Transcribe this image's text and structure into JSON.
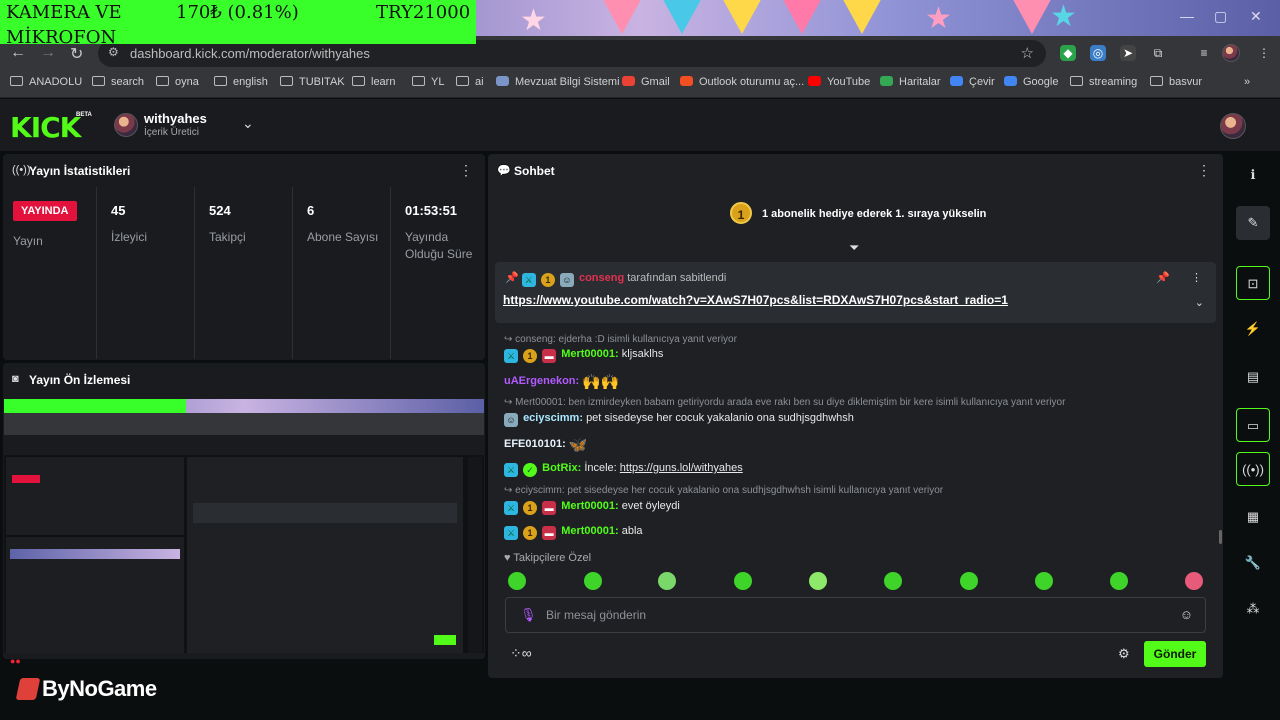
{
  "overlay": {
    "line1": "KAMERA VE",
    "line2": "MİKROFON",
    "price": "170₺ (0.81%)",
    "total": "TRY21000"
  },
  "browser": {
    "url": "dashboard.kick.com/moderator/withyahes",
    "bookmarks": [
      {
        "label": "ANADOLU",
        "icon": "folder-icon"
      },
      {
        "label": "search",
        "icon": "folder-icon"
      },
      {
        "label": "oyna",
        "icon": "folder-icon"
      },
      {
        "label": "english",
        "icon": "folder-icon"
      },
      {
        "label": "TUBITAK",
        "icon": "folder-icon"
      },
      {
        "label": "learn",
        "icon": "folder-icon"
      },
      {
        "label": "YL",
        "icon": "folder-icon"
      },
      {
        "label": "ai",
        "icon": "folder-icon"
      },
      {
        "label": "Mevzuat Bilgi Sistemi",
        "icon": "site-icon",
        "color": "#7b95c9"
      },
      {
        "label": "Gmail",
        "icon": "gmail-icon",
        "color": "#ea4335"
      },
      {
        "label": "Outlook oturumu aç...",
        "icon": "ms-icon",
        "color": "#f25022"
      },
      {
        "label": "YouTube",
        "icon": "youtube-icon",
        "color": "#ff0000"
      },
      {
        "label": "Haritalar",
        "icon": "maps-icon",
        "color": "#34a853"
      },
      {
        "label": "Çevir",
        "icon": "translate-icon",
        "color": "#4285f4"
      },
      {
        "label": "Google",
        "icon": "google-icon",
        "color": "#4285f4"
      },
      {
        "label": "streaming",
        "icon": "folder-icon"
      },
      {
        "label": "basvur",
        "icon": "folder-icon"
      }
    ]
  },
  "header": {
    "logo": "KICK",
    "beta": "BETA",
    "channel": "withyahes",
    "role": "İçerik Üretici"
  },
  "stats": {
    "title": "Yayın İstatistikleri",
    "live_badge": "YAYINDA",
    "live_label": "Yayın",
    "items": [
      {
        "value": "45",
        "label": "İzleyici"
      },
      {
        "value": "524",
        "label": "Takipçi"
      },
      {
        "value": "6",
        "label": "Abone Sayısı"
      },
      {
        "value": "01:53:51",
        "label": "Yayında Olduğu Süre"
      }
    ]
  },
  "preview": {
    "title": "Yayın Ön İzlemesi"
  },
  "chat": {
    "title": "Sohbet",
    "gift_coin": "1",
    "gift_banner": "1 abonelik hediye ederek 1. sıraya yükselin",
    "pinned": {
      "by_user": "conseng",
      "by_suffix": "tarafından sabitlendi",
      "link": "https://www.youtube.com/watch?v=XAwS7H07pcs&list=RDXAwS7H07pcs&start_radio=1"
    },
    "messages": [
      {
        "reply": "conseng: ejderha :D isimli kullanıcıya yanıt veriyor",
        "user": "Mert00001",
        "text": "kljsaklhs"
      },
      {
        "user": "uAErgenekon",
        "text": ""
      },
      {
        "reply": "Mert00001: ben izmirdeyken babam getiriyordu arada eve rakı ben su diye diklemiştim bir kere isimli kullanıcıya yanıt veriyor",
        "user": "eciyscimm",
        "text": "pet sisedeyse her cocuk yakalanio ona sudhjsgdhwhsh"
      },
      {
        "user": "EFE010101",
        "text": ""
      },
      {
        "user": "BotRix",
        "text": "İncele:",
        "link": "https://guns.lol/withyahes"
      },
      {
        "reply": "eciyscimm: pet sisedeyse her cocuk yakalanio ona sudhjsgdhwhsh isimli kullanıcıya yanıt veriyor",
        "user": "Mert00001",
        "text": "evet öyleydi"
      },
      {
        "user": "Mert00001",
        "text": "abla"
      }
    ],
    "follower_only": "Takipçilere Özel",
    "input_placeholder": "Bir mesaj gönderin",
    "send_label": "Gönder"
  },
  "brand_overlay": {
    "logo": "ByNoGame"
  },
  "colors": {
    "kick_green": "#53fc18",
    "live_red": "#e3123c",
    "panel_bg": "#191b1f",
    "chat_bg": "#1e2024"
  }
}
